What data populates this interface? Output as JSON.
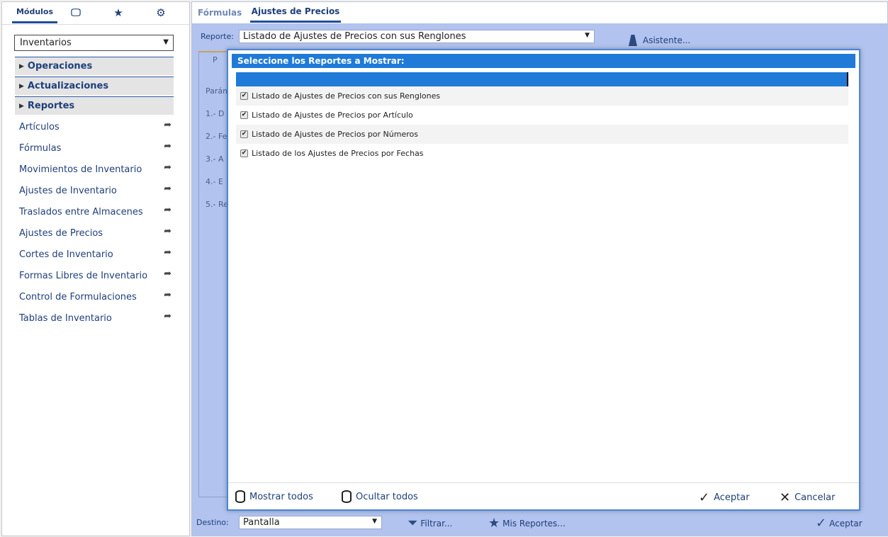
{
  "left": {
    "tabs": [
      {
        "label": "Módulos",
        "icon": ""
      },
      {
        "label": "",
        "icon": "monitor-icon",
        "glyph": "🖵"
      },
      {
        "label": "",
        "icon": "star-icon",
        "glyph": "★"
      },
      {
        "label": "",
        "icon": "gears-icon",
        "glyph": "⚙"
      }
    ],
    "module_select": "Inventarios",
    "sections": [
      "Operaciones",
      "Actualizaciones",
      "Reportes"
    ],
    "items": [
      "Artículos",
      "Fórmulas",
      "Movimientos de Inventario",
      "Ajustes de Inventario",
      "Traslados entre Almacenes",
      "Ajustes de Precios",
      "Cortes de Inventario",
      "Formas Libres de Inventario",
      "Control de Formulaciones",
      "Tablas de Inventario"
    ]
  },
  "right": {
    "tabs": [
      "Fórmulas",
      "Ajustes de Precios"
    ],
    "report_label": "Reporte:",
    "report_value": "Listado de Ajustes de Precios con sus Renglones",
    "asistente": "Asistente...",
    "params_title": "Parám",
    "params": [
      "1.- D",
      "2.- Fe",
      "3.- A",
      "4.- E",
      "5.- Re"
    ],
    "inner_tab_letter": "P",
    "destino_label": "Destino:",
    "destino_value": "Pantalla",
    "filtrar": "Filtrar...",
    "mis_reportes": "Mis Reportes...",
    "aceptar": "Aceptar"
  },
  "modal": {
    "title": "Seleccione los Reportes a Mostrar:",
    "reports": [
      {
        "label": "Listado de Ajustes de Precios con sus Renglones",
        "checked": true
      },
      {
        "label": "Listado de Ajustes de Precios por Artículo",
        "checked": true
      },
      {
        "label": "Listado de Ajustes de Precios por Números",
        "checked": true
      },
      {
        "label": "Listado de los Ajustes de Precios por Fechas",
        "checked": true
      }
    ],
    "mostrar_todos": "Mostrar todos",
    "ocultar_todos": "Ocultar todos",
    "aceptar": "Aceptar",
    "cancelar": "Cancelar"
  },
  "colors": {
    "accent": "#1f7ad8",
    "panel_bg": "#b1c3ee",
    "text_blue": "#1f3f7a"
  }
}
